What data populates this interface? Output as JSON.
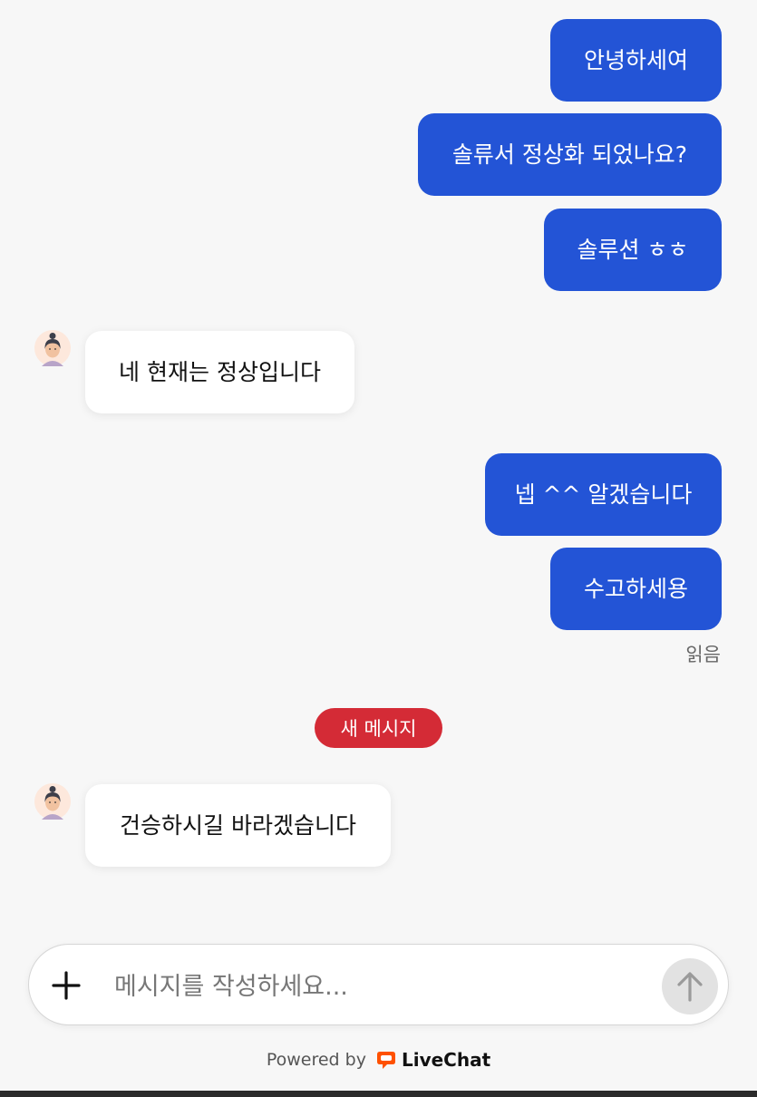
{
  "messages": {
    "out_1": "안녕하세여",
    "out_2": "솔류서 정상화 되었나요?",
    "out_3": "솔루션 ㅎㅎ",
    "in_1": "네 현재는 정상입니다",
    "out_4": "넵 ^^ 알겠습니다",
    "out_5": "수고하세용",
    "in_2": "건승하시길 바라겠습니다"
  },
  "read_status": "읽음",
  "new_messages_badge": "새 메시지",
  "composer": {
    "placeholder": "메시지를 작성하세요...",
    "attach_icon": "plus-icon",
    "send_icon": "arrow-up-icon"
  },
  "footer": {
    "powered_by": "Powered by",
    "brand": "LiveChat"
  },
  "colors": {
    "outgoing_bubble": "#2354d6",
    "incoming_bubble": "#ffffff",
    "badge": "#d42b36",
    "brand_accent": "#ff5100"
  }
}
